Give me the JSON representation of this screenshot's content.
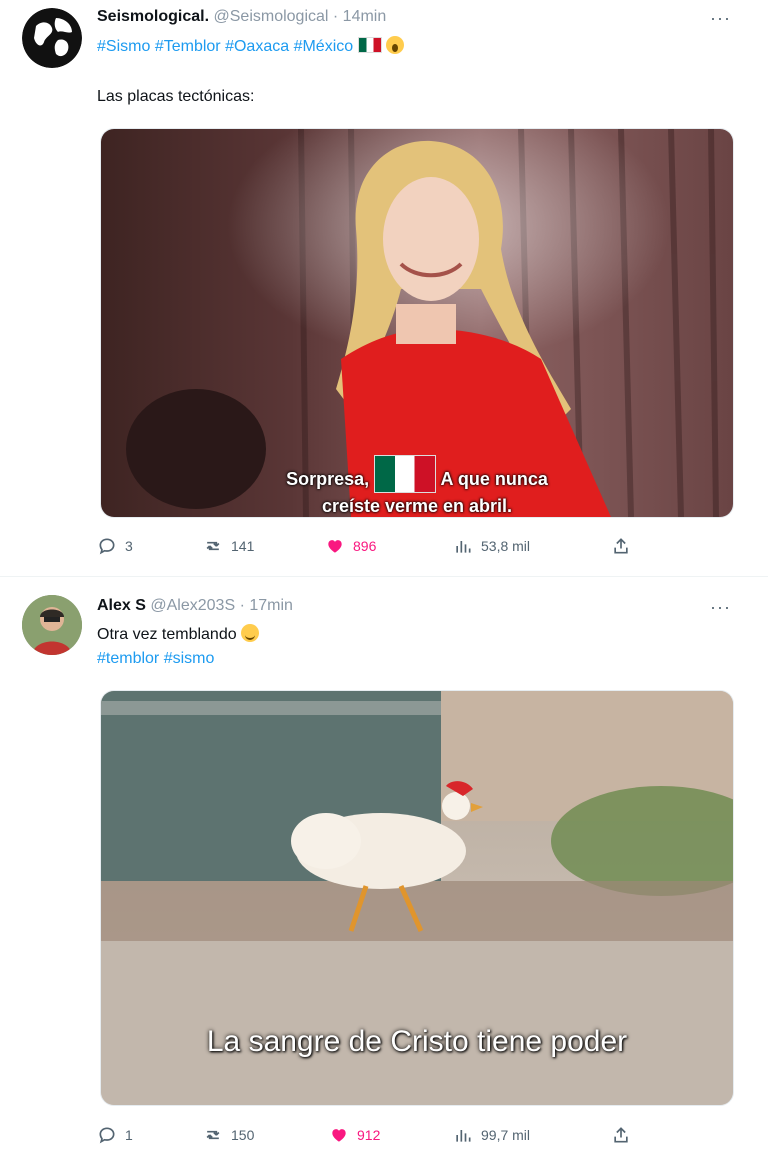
{
  "tweets": [
    {
      "name": "Seismological.",
      "handle": "@Seismological",
      "time": "· 14min",
      "hashtags": [
        "#Sismo",
        "#Temblor",
        "#Oaxaca",
        "#México"
      ],
      "text": "Las placas tectónicas:",
      "media_caption_line1_a": "Sorpresa,",
      "media_caption_line1_b": "A que nunca",
      "media_caption_line2": "creíste verme en abril.",
      "replies": "3",
      "retweets": "141",
      "likes": "896",
      "views": "53,8 mil"
    },
    {
      "name": "Alex S",
      "handle": "@Alex203S",
      "time": "· 17min",
      "text": "Otra vez temblando",
      "hashtags": [
        "#temblor",
        "#sismo"
      ],
      "media_caption": "La sangre de Cristo tiene poder",
      "replies": "1",
      "retweets": "150",
      "likes": "912",
      "views": "99,7 mil"
    }
  ],
  "colors": {
    "link": "#1d9bf0",
    "like": "#f91880",
    "muted": "#536471"
  },
  "icons": [
    "globe-avatar-icon",
    "more-icon",
    "reply-icon",
    "retweet-icon",
    "like-icon",
    "views-icon",
    "share-icon",
    "mexico-flag-icon",
    "scream-emoji-icon",
    "smile-emoji-icon"
  ]
}
